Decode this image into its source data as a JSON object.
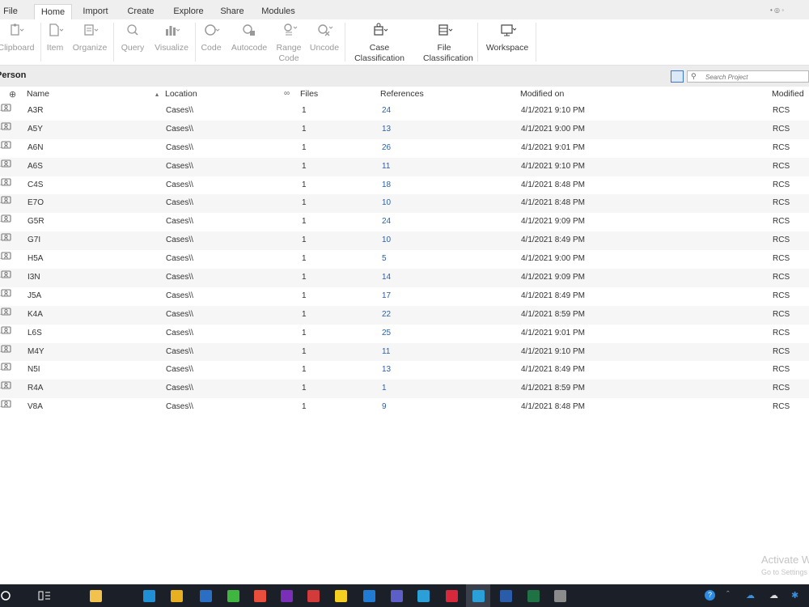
{
  "menu": {
    "tabs": [
      "File",
      "Home",
      "Import",
      "Create",
      "Explore",
      "Share",
      "Modules"
    ],
    "active": "Home"
  },
  "ribbon": {
    "buttons": [
      {
        "label": "Clipboard",
        "icon": "clipboard-icon"
      },
      {
        "label": "Item",
        "icon": "item-icon"
      },
      {
        "label": "Organize",
        "icon": "organize-icon"
      },
      {
        "label": "Query",
        "icon": "query-icon"
      },
      {
        "label": "Visualize",
        "icon": "visualize-icon"
      },
      {
        "label": "Code",
        "icon": "code-icon"
      },
      {
        "label": "Autocode",
        "icon": "autocode-icon"
      },
      {
        "label": "Range Code",
        "icon": "range-code-icon"
      },
      {
        "label": "Uncode",
        "icon": "uncode-icon"
      },
      {
        "label": "Case Classification",
        "icon": "case-classification-icon"
      },
      {
        "label": "File Classification",
        "icon": "file-classification-icon"
      },
      {
        "label": "Workspace",
        "icon": "workspace-icon"
      }
    ]
  },
  "list": {
    "title": "Person",
    "search_placeholder": "Search Project",
    "columns": {
      "name": "Name",
      "location": "Location",
      "files": "Files",
      "references": "References",
      "modified_on": "Modified on",
      "modified_by": "Modified"
    },
    "rows": [
      {
        "name": "A3R",
        "location": "Cases\\\\",
        "files": "1",
        "references": "24",
        "modified_on": "4/1/2021 9:10 PM",
        "modified_by": "RCS"
      },
      {
        "name": "A5Y",
        "location": "Cases\\\\",
        "files": "1",
        "references": "13",
        "modified_on": "4/1/2021 9:00 PM",
        "modified_by": "RCS"
      },
      {
        "name": "A6N",
        "location": "Cases\\\\",
        "files": "1",
        "references": "26",
        "modified_on": "4/1/2021 9:01 PM",
        "modified_by": "RCS"
      },
      {
        "name": "A6S",
        "location": "Cases\\\\",
        "files": "1",
        "references": "11",
        "modified_on": "4/1/2021 9:10 PM",
        "modified_by": "RCS"
      },
      {
        "name": "C4S",
        "location": "Cases\\\\",
        "files": "1",
        "references": "18",
        "modified_on": "4/1/2021 8:48 PM",
        "modified_by": "RCS"
      },
      {
        "name": "E7O",
        "location": "Cases\\\\",
        "files": "1",
        "references": "10",
        "modified_on": "4/1/2021 8:48 PM",
        "modified_by": "RCS"
      },
      {
        "name": "G5R",
        "location": "Cases\\\\",
        "files": "1",
        "references": "24",
        "modified_on": "4/1/2021 9:09 PM",
        "modified_by": "RCS"
      },
      {
        "name": "G7I",
        "location": "Cases\\\\",
        "files": "1",
        "references": "10",
        "modified_on": "4/1/2021 8:49 PM",
        "modified_by": "RCS"
      },
      {
        "name": "H5A",
        "location": "Cases\\\\",
        "files": "1",
        "references": "5",
        "modified_on": "4/1/2021 9:00 PM",
        "modified_by": "RCS"
      },
      {
        "name": "I3N",
        "location": "Cases\\\\",
        "files": "1",
        "references": "14",
        "modified_on": "4/1/2021 9:09 PM",
        "modified_by": "RCS"
      },
      {
        "name": "J5A",
        "location": "Cases\\\\",
        "files": "1",
        "references": "17",
        "modified_on": "4/1/2021 8:49 PM",
        "modified_by": "RCS"
      },
      {
        "name": "K4A",
        "location": "Cases\\\\",
        "files": "1",
        "references": "22",
        "modified_on": "4/1/2021 8:59 PM",
        "modified_by": "RCS"
      },
      {
        "name": "L6S",
        "location": "Cases\\\\",
        "files": "1",
        "references": "25",
        "modified_on": "4/1/2021 9:01 PM",
        "modified_by": "RCS"
      },
      {
        "name": "M4Y",
        "location": "Cases\\\\",
        "files": "1",
        "references": "11",
        "modified_on": "4/1/2021 9:10 PM",
        "modified_by": "RCS"
      },
      {
        "name": "N5I",
        "location": "Cases\\\\",
        "files": "1",
        "references": "13",
        "modified_on": "4/1/2021 8:49 PM",
        "modified_by": "RCS"
      },
      {
        "name": "R4A",
        "location": "Cases\\\\",
        "files": "1",
        "references": "1",
        "modified_on": "4/1/2021 8:59 PM",
        "modified_by": "RCS"
      },
      {
        "name": "V8A",
        "location": "Cases\\\\",
        "files": "1",
        "references": "9",
        "modified_on": "4/1/2021 8:48 PM",
        "modified_by": "RCS"
      }
    ]
  },
  "watermark": {
    "line1": "Activate Windows",
    "line2": "Go to Settings to activate Windows."
  },
  "taskbar": {
    "apps": [
      {
        "icon": "file-explorer-icon",
        "color": "#f2c14e"
      },
      {
        "icon": "infinity-app-icon",
        "color": "#1b1f27"
      },
      {
        "icon": "edge-icon",
        "color": "#1f8fd6"
      },
      {
        "icon": "chrome-icon",
        "color": "#e8b021"
      },
      {
        "icon": "mail-icon",
        "color": "#2b6fc4"
      },
      {
        "icon": "camtasia-icon",
        "color": "#3fb640"
      },
      {
        "icon": "acrobat-icon",
        "color": "#e94e3c"
      },
      {
        "icon": "onenote-icon",
        "color": "#7b2fb8"
      },
      {
        "icon": "red-app-icon",
        "color": "#d33b3b"
      },
      {
        "icon": "miro-icon",
        "color": "#f5d020"
      },
      {
        "icon": "trello-icon",
        "color": "#1f7bd4"
      },
      {
        "icon": "teams-icon",
        "color": "#5b5fc7"
      },
      {
        "icon": "nvivo-icon",
        "color": "#2a9fd8"
      },
      {
        "icon": "red-network-icon",
        "color": "#d8283c"
      },
      {
        "icon": "blue-network-icon",
        "color": "#2a9fd8"
      },
      {
        "icon": "word-icon",
        "color": "#2b5caa"
      },
      {
        "icon": "excel-icon",
        "color": "#1f7244"
      },
      {
        "icon": "paint-icon",
        "color": "#8b8b8b"
      }
    ],
    "tray_icons": [
      "help-icon",
      "onedrive-icon",
      "cloud-icon",
      "bluetooth-icon"
    ]
  }
}
